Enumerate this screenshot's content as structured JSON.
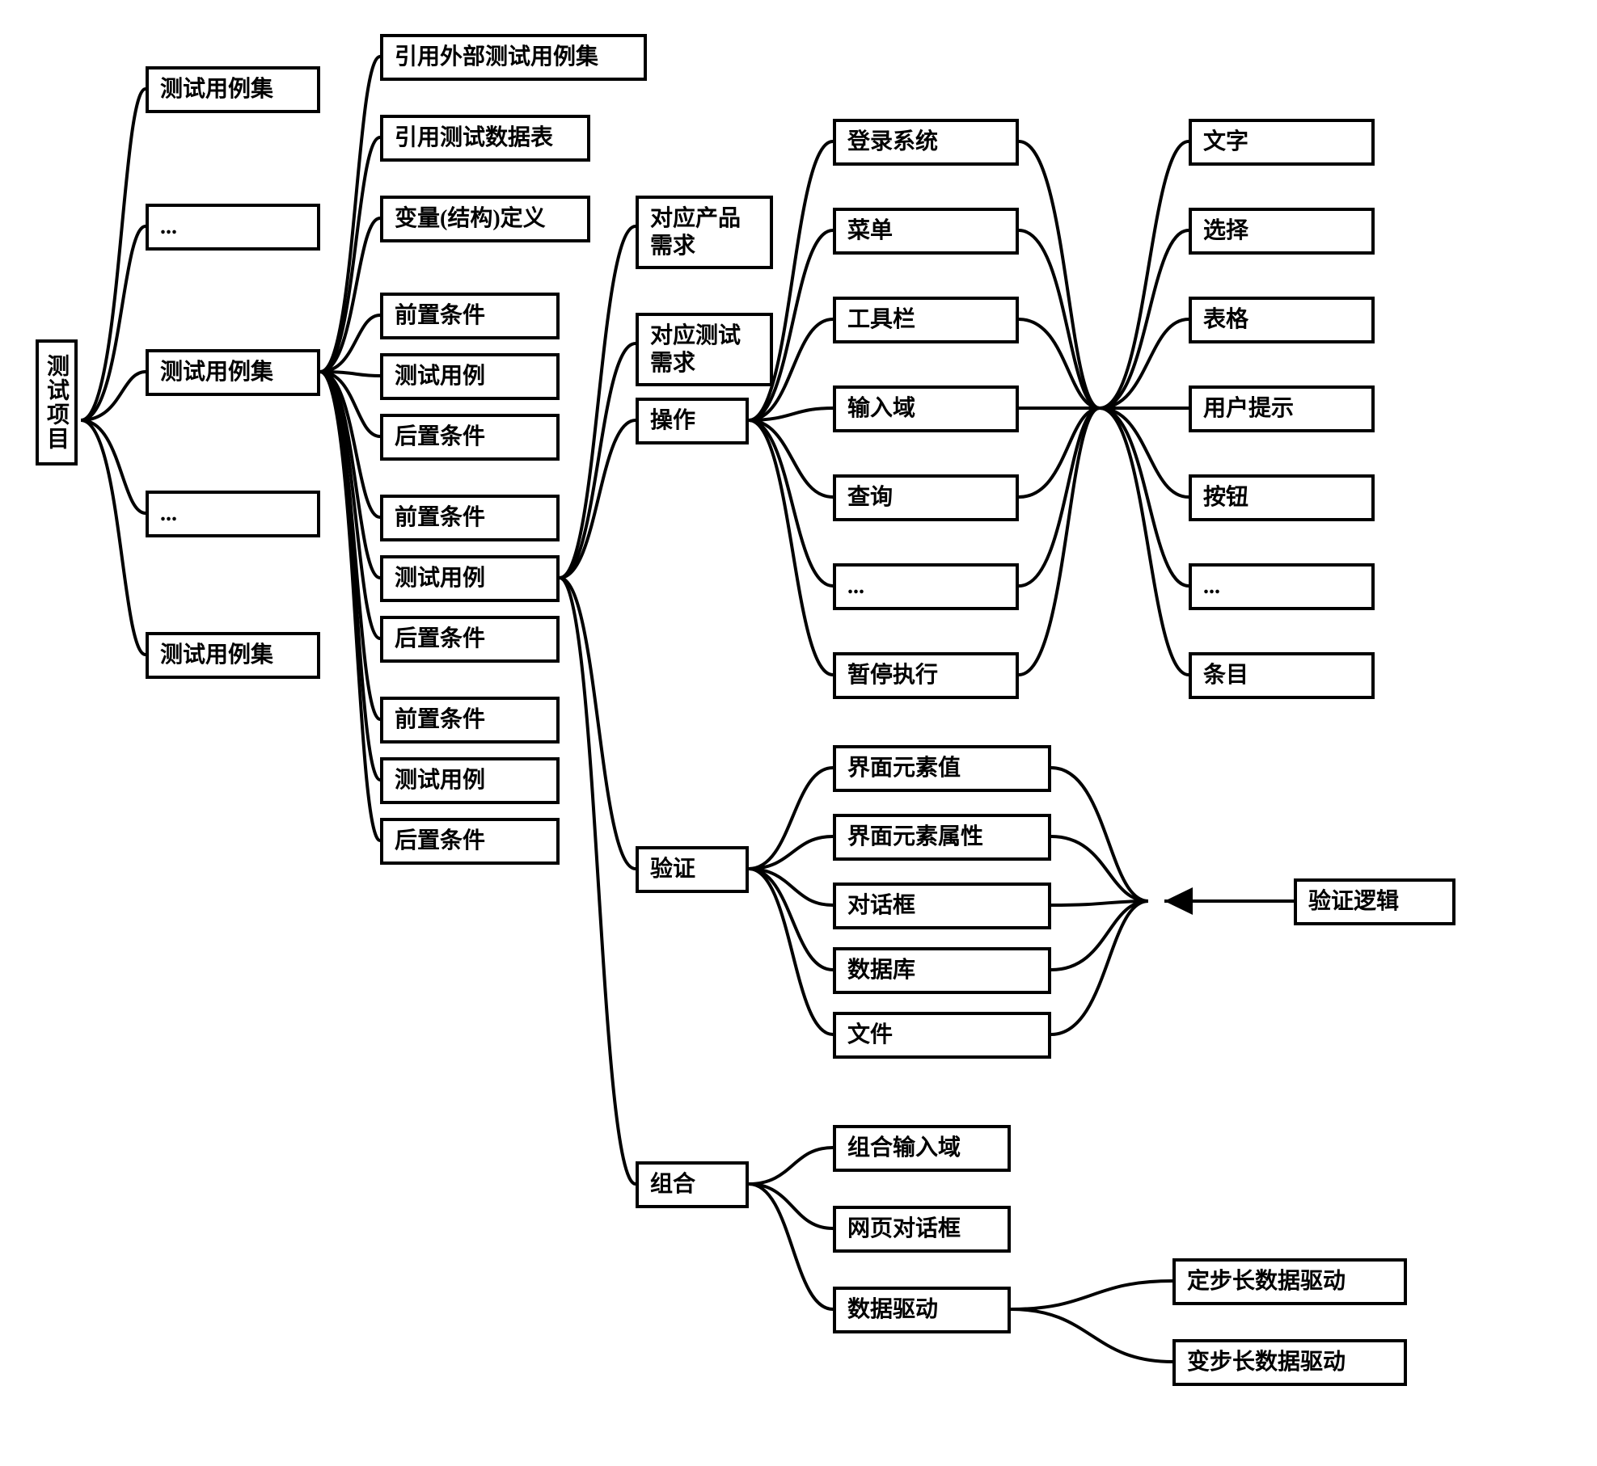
{
  "col0": {
    "root": "测试项目"
  },
  "col1": {
    "i0": "测试用例集",
    "i1": "...",
    "i2": "测试用例集",
    "i3": "...",
    "i4": "测试用例集"
  },
  "col2": {
    "top": {
      "i0": "引用外部测试用例集",
      "i1": "引用测试数据表",
      "i2": "变量(结构)定义"
    },
    "g1": {
      "pre": "前置条件",
      "tc": "测试用例",
      "post": "后置条件"
    },
    "g2": {
      "pre": "前置条件",
      "tc": "测试用例",
      "post": "后置条件"
    },
    "g3": {
      "pre": "前置条件",
      "tc": "测试用例",
      "post": "后置条件"
    }
  },
  "col3": {
    "i0": "对应产品需求",
    "i1": "对应测试需求",
    "i2": "操作",
    "i3": "验证",
    "i4": "组合"
  },
  "col4ops": {
    "i0": "登录系统",
    "i1": "菜单",
    "i2": "工具栏",
    "i3": "输入域",
    "i4": "查询",
    "i5": "...",
    "i6": "暂停执行"
  },
  "col5": {
    "i0": "文字",
    "i1": "选择",
    "i2": "表格",
    "i3": "用户提示",
    "i4": "按钮",
    "i5": "...",
    "i6": "条目"
  },
  "verify": {
    "i0": "界面元素值",
    "i1": "界面元素属性",
    "i2": "对话框",
    "i3": "数据库",
    "i4": "文件",
    "logic": "验证逻辑"
  },
  "combo": {
    "i0": "组合输入域",
    "i1": "网页对话框",
    "i2": "数据驱动"
  },
  "datadrive": {
    "i0": "定步长数据驱动",
    "i1": "变步长数据驱动"
  }
}
